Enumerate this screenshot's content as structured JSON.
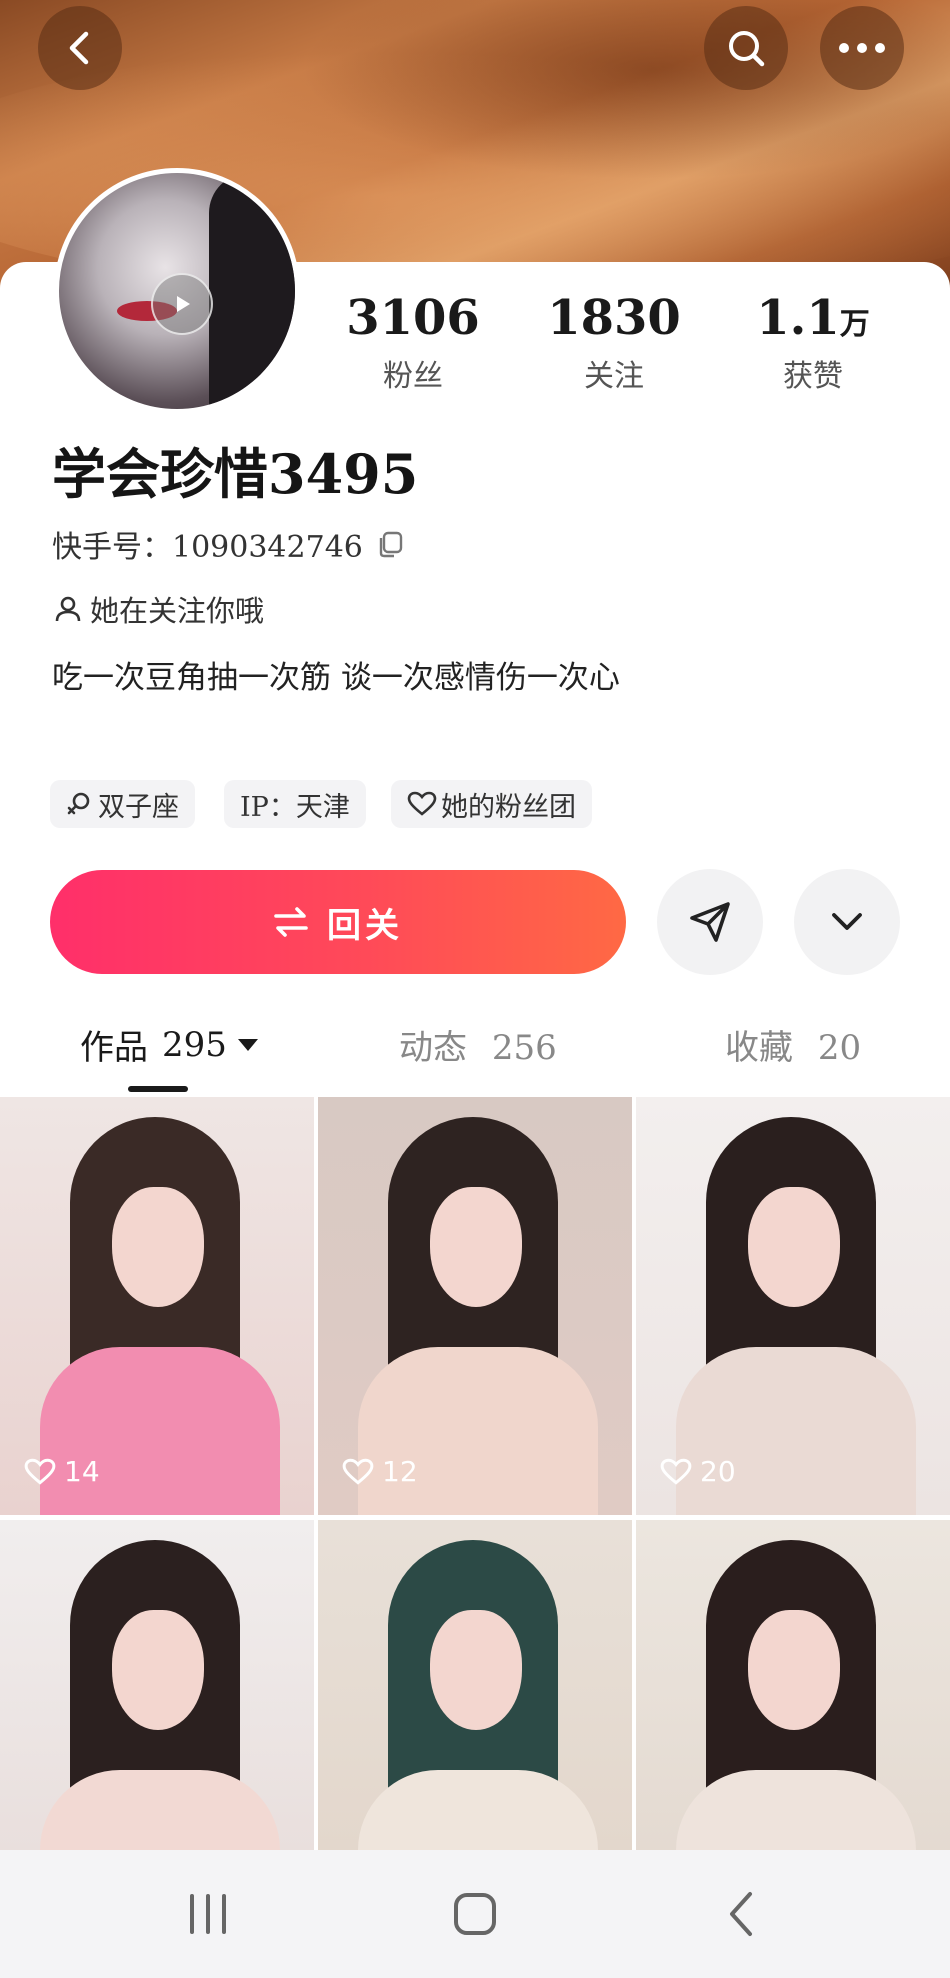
{
  "header": {
    "back_icon": "chevron-left-icon",
    "search_icon": "search-icon",
    "more_icon": "more-horizontal-icon"
  },
  "profile": {
    "name": "学会珍惜3495",
    "kuaishou_id": "快手号：1090342746",
    "follow_note": "她在关注你哦",
    "bio": "吃一次豆角抽一次筋 谈一次感情伤一次心",
    "stats": [
      {
        "value": "3106",
        "unit": "",
        "label": "粉丝"
      },
      {
        "value": "1830",
        "unit": "",
        "label": "关注"
      },
      {
        "value": "1.1",
        "unit": "万",
        "label": "获赞"
      }
    ],
    "tags": [
      {
        "icon": "gender-female-icon",
        "label": "双子座"
      },
      {
        "icon": "",
        "label": "IP：天津"
      },
      {
        "icon": "heart-outline-icon",
        "label": "她的粉丝团"
      }
    ]
  },
  "actions": {
    "follow_back_label": "回关",
    "accent_start": "#ff2f6a",
    "accent_end": "#ff6944"
  },
  "tabs": [
    {
      "label": "作品",
      "count": "295",
      "active": true
    },
    {
      "label": "动态",
      "count": "256",
      "active": false
    },
    {
      "label": "收藏",
      "count": "20",
      "active": false
    }
  ],
  "grid": [
    {
      "likes": "14"
    },
    {
      "likes": "12"
    },
    {
      "likes": "20"
    },
    {
      "likes": ""
    },
    {
      "likes": ""
    },
    {
      "likes": ""
    }
  ],
  "navbar": {
    "recents_icon": "recent-apps-icon",
    "home_icon": "home-square-icon",
    "back_icon": "nav-back-icon"
  }
}
